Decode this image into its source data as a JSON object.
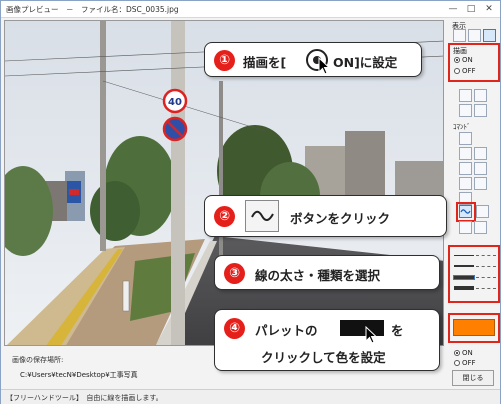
{
  "window": {
    "title": "画像プレビュー　－　ファイル名：DSC_0035.jpg",
    "minimize": "—",
    "maximize": "□",
    "close": "✕"
  },
  "photo": {
    "sign_speed_limit": "40"
  },
  "save": {
    "label": "画像の保存場所:",
    "path": "C:¥Users¥tecN¥Desktop¥工事写真"
  },
  "status": {
    "text": "【フリーハンドツール】　自由に線を描画します。"
  },
  "panel": {
    "display_label": "表示",
    "draw_label": "描画",
    "on": "ON",
    "off": "OFF",
    "command_label": "ｺﾏﾝﾄﾞ",
    "close_button": "閉じる",
    "lower_on": "ON",
    "lower_off": "OFF"
  },
  "colors": {
    "palette_selected": "#ff8000",
    "accent_red": "#e0251c"
  },
  "callouts": {
    "c1": {
      "num": "①",
      "text_pre": "描画を[",
      "text_post": "ON]に設定"
    },
    "c2": {
      "num": "②",
      "text": "ボタンをクリック"
    },
    "c3": {
      "num": "③",
      "text": "線の太さ・種類を選択"
    },
    "c4": {
      "num": "④",
      "line1_pre": "パレットの",
      "line1_post": "を",
      "line2": "クリックして色を設定"
    }
  },
  "icons": [
    "radio-on-icon",
    "cursor-arrow-icon",
    "freehand-wave-icon",
    "zoom-in-icon",
    "zoom-out-icon",
    "hand-icon",
    "undo-icon",
    "pin-icon",
    "line-icon",
    "arrow-icon",
    "rectangle-icon",
    "filled-rectangle-icon",
    "circle-icon",
    "text-icon",
    "eraser-icon"
  ]
}
